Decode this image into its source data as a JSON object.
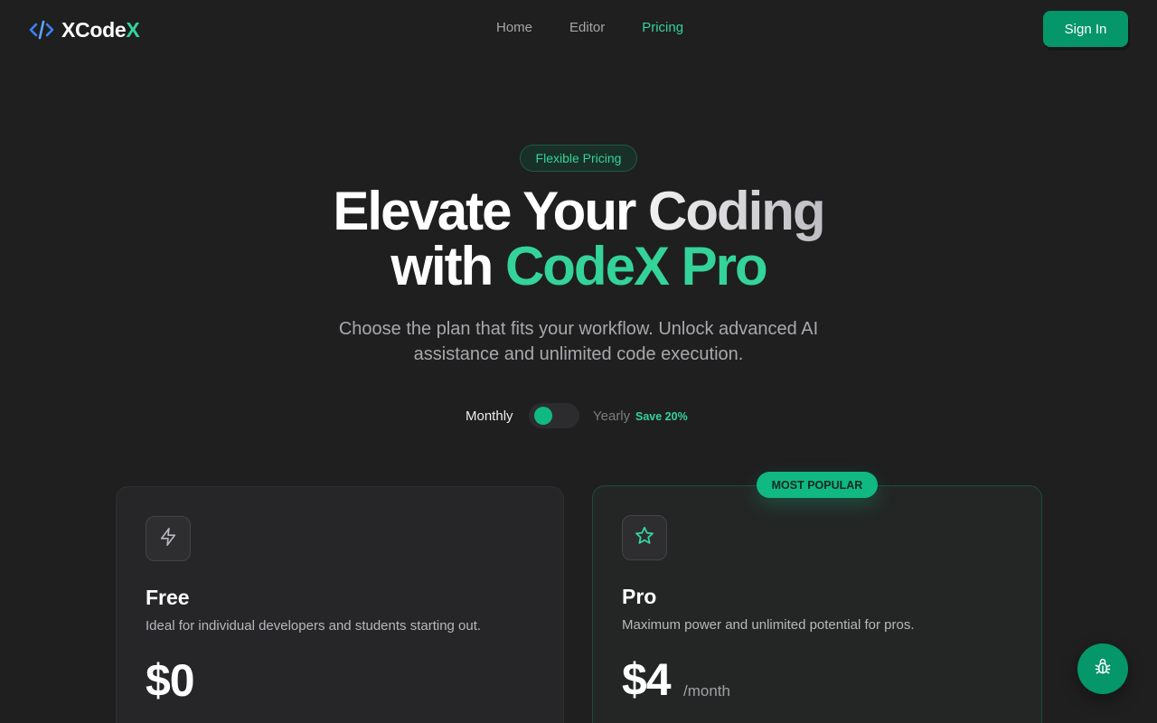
{
  "header": {
    "logo_text": "XCode",
    "logo_accent": "X",
    "nav": [
      {
        "label": "Home",
        "active": false
      },
      {
        "label": "Editor",
        "active": false
      },
      {
        "label": "Pricing",
        "active": true
      }
    ],
    "signin_label": "Sign In"
  },
  "hero": {
    "badge": "Flexible Pricing",
    "title_line1_a": "Elevate Your ",
    "title_line1_b": "Coding",
    "title_line2_a": "with ",
    "title_line2_b": "CodeX Pro",
    "subtitle": "Choose the plan that fits your workflow. Unlock advanced AI assistance and unlimited code execution."
  },
  "billing": {
    "monthly_label": "Monthly",
    "yearly_label": "Yearly",
    "save_label": "Save 20%",
    "selected": "Monthly"
  },
  "plans": [
    {
      "name": "Free",
      "description": "Ideal for individual developers and students starting out.",
      "price": "$0",
      "period": "",
      "icon": "lightning-icon"
    },
    {
      "name": "Pro",
      "description": "Maximum power and unlimited potential for pros.",
      "price": "$4",
      "period": "/month",
      "icon": "star-icon",
      "badge": "MOST POPULAR"
    }
  ],
  "fab_icon": "bug-icon",
  "colors": {
    "accent": "#34d399",
    "primary_button": "#059669",
    "background": "#1f1f20"
  }
}
